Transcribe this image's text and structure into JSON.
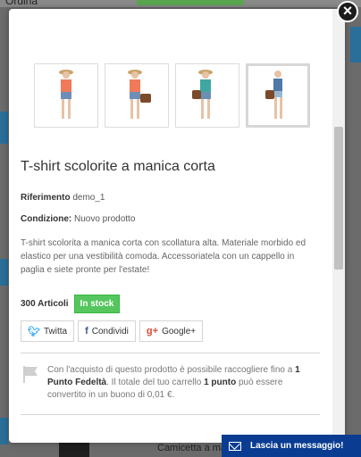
{
  "background": {
    "sort_label": "Ordina",
    "bottom_product": "Camicetta a manica"
  },
  "modal": {
    "thumbnails": [
      {
        "name": "model-orange-top-hat"
      },
      {
        "name": "model-orange-top-bag"
      },
      {
        "name": "model-teal-top-bag"
      },
      {
        "name": "model-blue-top-bag"
      }
    ],
    "title": "T-shirt scolorite a manica corta",
    "reference_label": "Riferimento",
    "reference_value": "demo_1",
    "condition_label": "Condizione:",
    "condition_value": "Nuovo prodotto",
    "description": "T-shirt scolorita a manica corta con scollatura alta. Materiale morbido ed elastico per una vestibilità comoda. Accessoriatela con un cappello in paglia e siete pronte per l'estate!",
    "quantity_text": "300 Articoli",
    "stock_label": "In stock",
    "share": {
      "twitter": "Twitta",
      "facebook": "Condividi",
      "google": "Google+"
    },
    "loyalty": {
      "part1": "Con l'acquisto di questo prodotto è possibile raccogliere fino a ",
      "points_bold": "1 Punto Fedeltà",
      "part2": ". Il totale del tuo carrello ",
      "cart_points_bold": "1 punto",
      "part3": " può essere convertito in un buono di 0,01 €."
    }
  },
  "close_symbol": "×",
  "chat_label": "Lascia un messaggio!",
  "colors": {
    "instock_green": "#55c65e",
    "chat_blue": "#0a3d91",
    "twitter": "#1da1f2",
    "facebook": "#3b5998",
    "google": "#dd4b39"
  }
}
